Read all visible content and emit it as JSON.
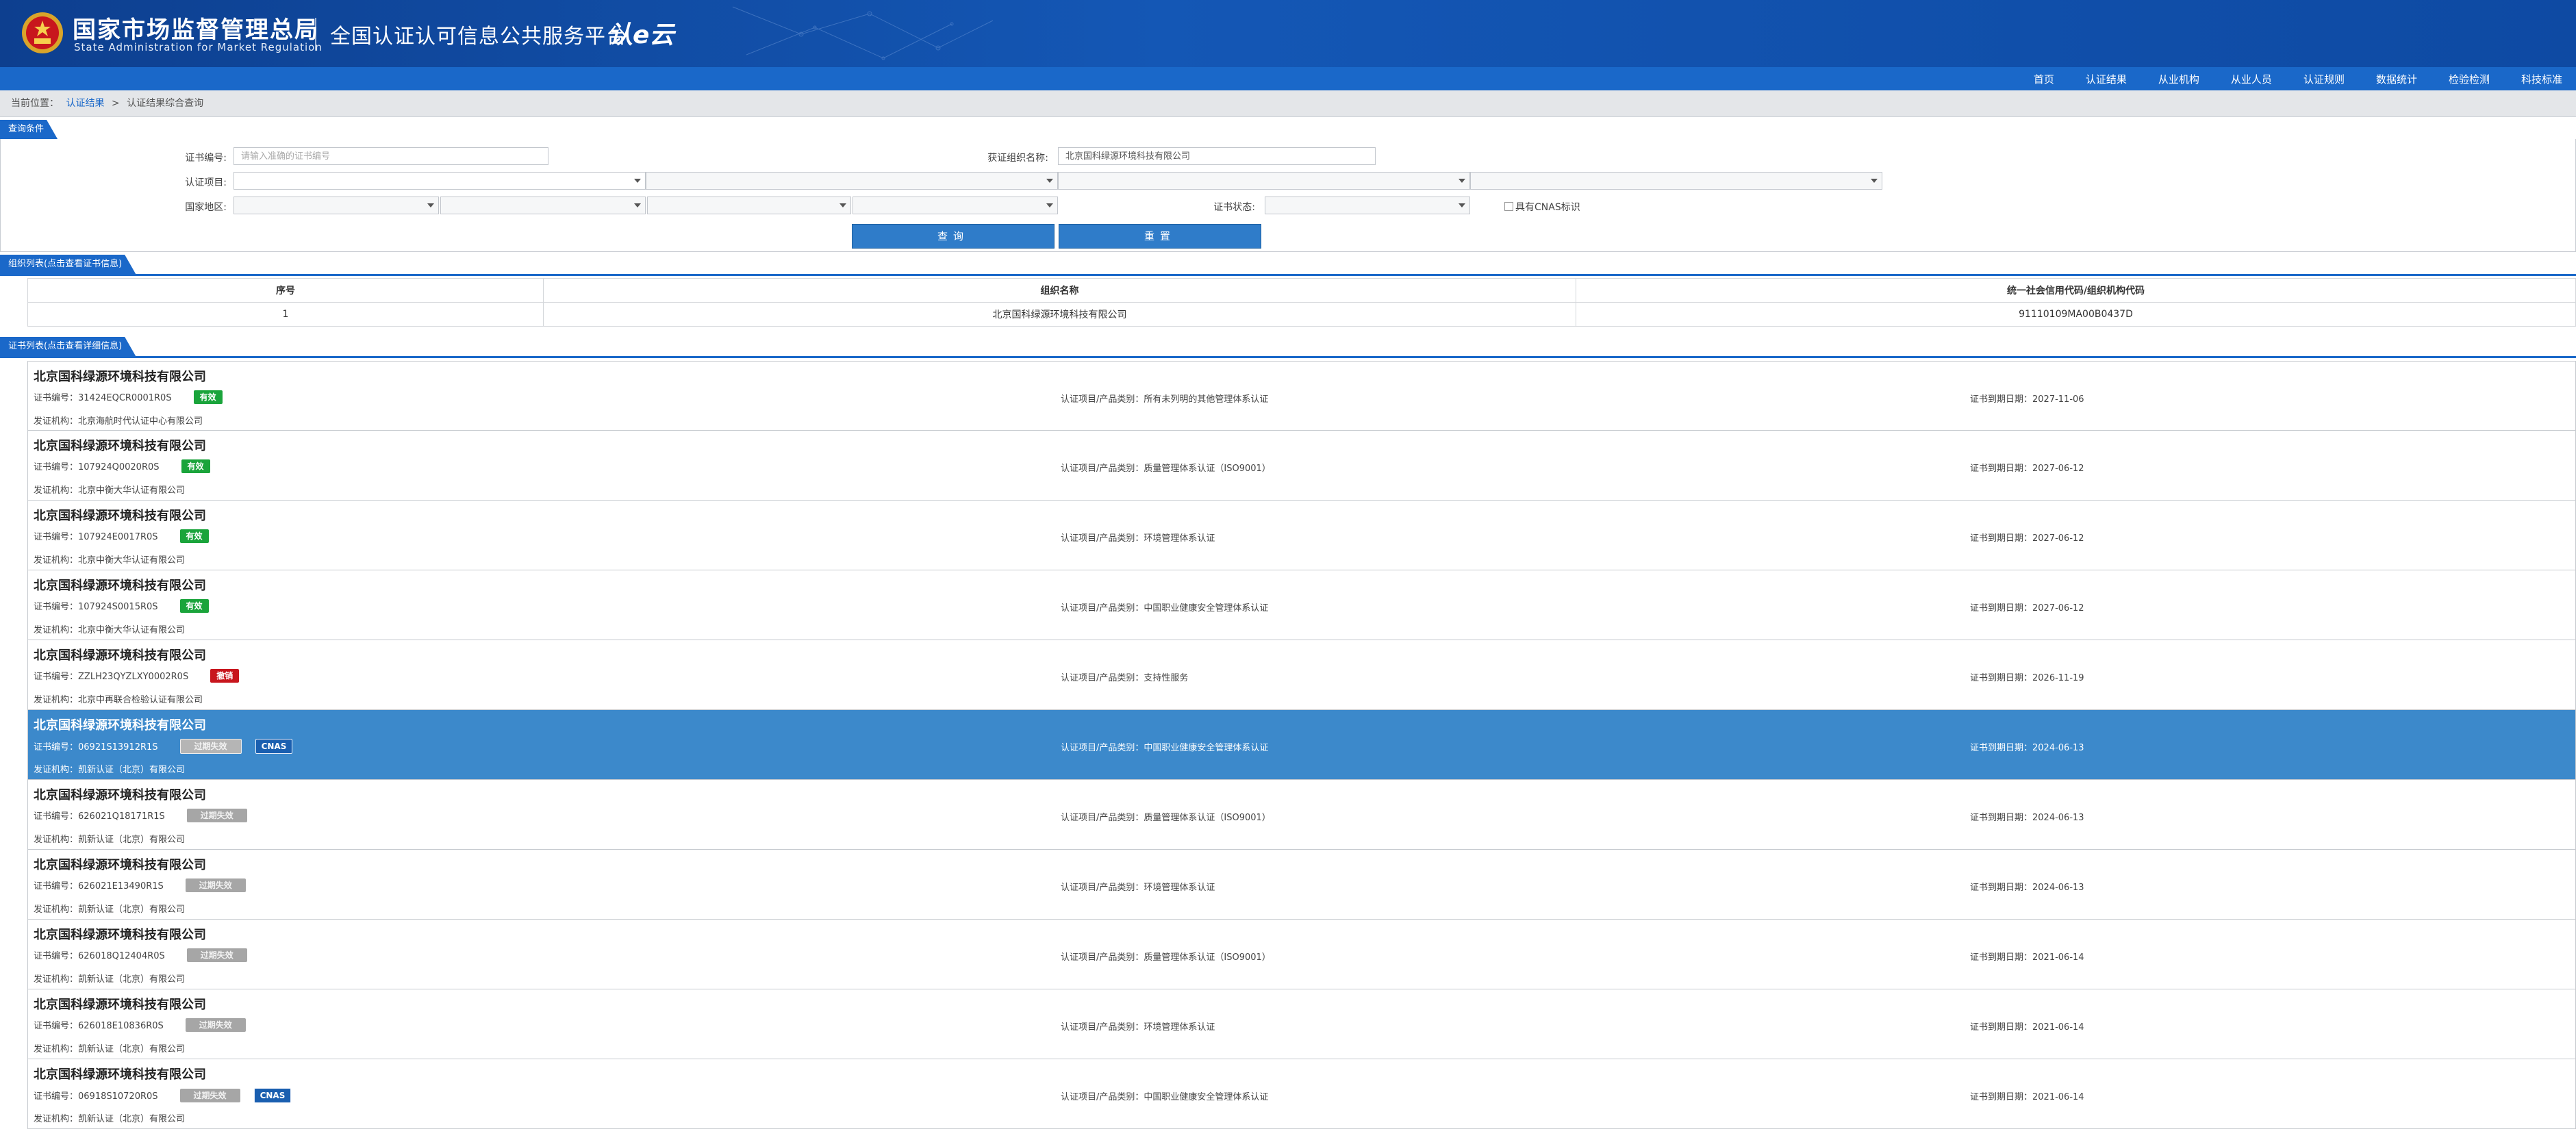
{
  "header": {
    "org_cn": "国家市场监督管理总局",
    "org_en": "State Administration  for  Market Regulation",
    "platform_title": "全国认证认可信息公共服务平台",
    "platform_logo": "认e云"
  },
  "nav": {
    "items": [
      "首页",
      "认证结果",
      "从业机构",
      "从业人员",
      "认证规则",
      "数据统计",
      "检验检测",
      "科技标准"
    ]
  },
  "breadcrumb": {
    "label": "当前位置：",
    "link": "认证结果",
    "separator": ">",
    "current": "认证结果综合查询"
  },
  "query": {
    "section_title": "查询条件",
    "cert_no_label": "证书编号:",
    "cert_no_placeholder": "请输入准确的证书编号",
    "org_name_label": "获证组织名称:",
    "org_name_value": "北京国科绿源环境科技有限公司",
    "cert_item_label": "认证项目:",
    "region_label": "国家地区:",
    "status_label": "证书状态:",
    "cnas_label": "具有CNAS标识",
    "search_button": "查询",
    "reset_button": "重置"
  },
  "org_list": {
    "section_title": "组织列表(点击查看证书信息)",
    "columns": [
      "序号",
      "组织名称",
      "统一社会信用代码/组织机构代码"
    ],
    "rows": [
      {
        "index": "1",
        "name": "北京国科绿源环境科技有限公司",
        "code": "91110109MA00B0437D"
      }
    ]
  },
  "cert_list": {
    "section_title": "证书列表(点击查看详细信息)",
    "cert_no_prefix": "证书编号：",
    "item_prefix": "认证项目/产品类别：",
    "expiry_prefix": "证书到期日期：",
    "issuer_prefix": "发证机构：",
    "items": [
      {
        "org": "北京国科绿源环境科技有限公司",
        "cert_no": "31424EQCR0001R0S",
        "status": "有效",
        "status_type": "valid",
        "cnas": "",
        "item": "所有未列明的其他管理体系认证",
        "expiry": "2027-11-06",
        "issuer": "北京海航时代认证中心有限公司"
      },
      {
        "org": "北京国科绿源环境科技有限公司",
        "cert_no": "107924Q0020R0S",
        "status": "有效",
        "status_type": "valid",
        "cnas": "",
        "item": "质量管理体系认证（ISO9001）",
        "expiry": "2027-06-12",
        "issuer": "北京中衡大华认证有限公司"
      },
      {
        "org": "北京国科绿源环境科技有限公司",
        "cert_no": "107924E0017R0S",
        "status": "有效",
        "status_type": "valid",
        "cnas": "",
        "item": "环境管理体系认证",
        "expiry": "2027-06-12",
        "issuer": "北京中衡大华认证有限公司"
      },
      {
        "org": "北京国科绿源环境科技有限公司",
        "cert_no": "107924S0015R0S",
        "status": "有效",
        "status_type": "valid",
        "cnas": "",
        "item": "中国职业健康安全管理体系认证",
        "expiry": "2027-06-12",
        "issuer": "北京中衡大华认证有限公司"
      },
      {
        "org": "北京国科绿源环境科技有限公司",
        "cert_no": "ZZLH23QYZLXY0002R0S",
        "status": "撤销",
        "status_type": "revoked",
        "cnas": "",
        "item": "支持性服务",
        "expiry": "2026-11-19",
        "issuer": "北京中再联合检验认证有限公司"
      },
      {
        "org": "北京国科绿源环境科技有限公司",
        "cert_no": "06921S13912R1S",
        "status": "过期失效",
        "status_type": "expired",
        "cnas": "CNAS",
        "item": "中国职业健康安全管理体系认证",
        "expiry": "2024-06-13",
        "issuer": "凯新认证（北京）有限公司",
        "selected": true
      },
      {
        "org": "北京国科绿源环境科技有限公司",
        "cert_no": "626021Q18171R1S",
        "status": "过期失效",
        "status_type": "expired",
        "cnas": "",
        "item": "质量管理体系认证（ISO9001）",
        "expiry": "2024-06-13",
        "issuer": "凯新认证（北京）有限公司"
      },
      {
        "org": "北京国科绿源环境科技有限公司",
        "cert_no": "626021E13490R1S",
        "status": "过期失效",
        "status_type": "expired",
        "cnas": "",
        "item": "环境管理体系认证",
        "expiry": "2024-06-13",
        "issuer": "凯新认证（北京）有限公司"
      },
      {
        "org": "北京国科绿源环境科技有限公司",
        "cert_no": "626018Q12404R0S",
        "status": "过期失效",
        "status_type": "expired",
        "cnas": "",
        "item": "质量管理体系认证（ISO9001）",
        "expiry": "2021-06-14",
        "issuer": "凯新认证（北京）有限公司"
      },
      {
        "org": "北京国科绿源环境科技有限公司",
        "cert_no": "626018E10836R0S",
        "status": "过期失效",
        "status_type": "expired",
        "cnas": "",
        "item": "环境管理体系认证",
        "expiry": "2021-06-14",
        "issuer": "凯新认证（北京）有限公司"
      },
      {
        "org": "北京国科绿源环境科技有限公司",
        "cert_no": "06918S10720R0S",
        "status": "过期失效",
        "status_type": "expired",
        "cnas": "CNAS",
        "item": "中国职业健康安全管理体系认证",
        "expiry": "2021-06-14",
        "issuer": "凯新认证（北京）有限公司"
      }
    ]
  },
  "colors": {
    "header_blue": "#0d3f8f",
    "nav_blue": "#1a68c9",
    "selected_row": "#3c89cb",
    "valid_green": "#1aa43b",
    "revoked_red": "#c8161d",
    "expired_gray": "#a6a6a6",
    "cnas_blue": "#1a5fb0"
  },
  "icons": {
    "emblem": "national-emblem-icon",
    "dropdown": "chevron-down-icon",
    "checkbox": "checkbox-icon"
  }
}
